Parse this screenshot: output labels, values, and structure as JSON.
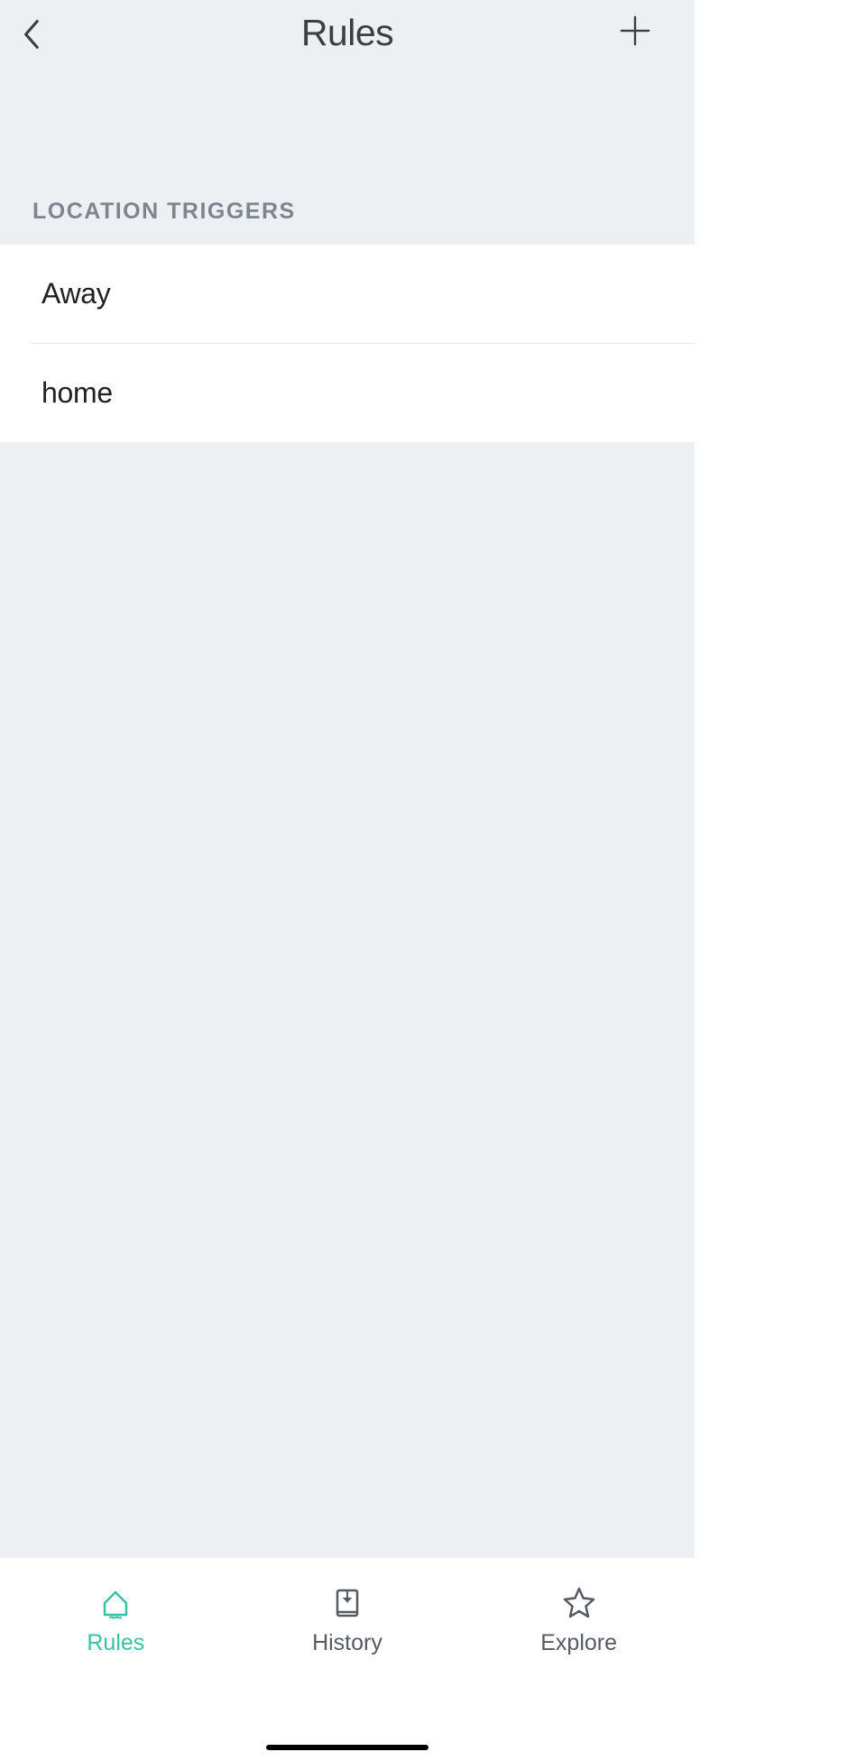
{
  "header": {
    "title": "Rules"
  },
  "section": {
    "title": "LOCATION TRIGGERS"
  },
  "rules": [
    {
      "label": "Away"
    },
    {
      "label": "home"
    }
  ],
  "tabs": {
    "rules": "Rules",
    "history": "History",
    "explore": "Explore"
  },
  "colors": {
    "accent": "#38c1a3",
    "muted": "#565b63"
  }
}
